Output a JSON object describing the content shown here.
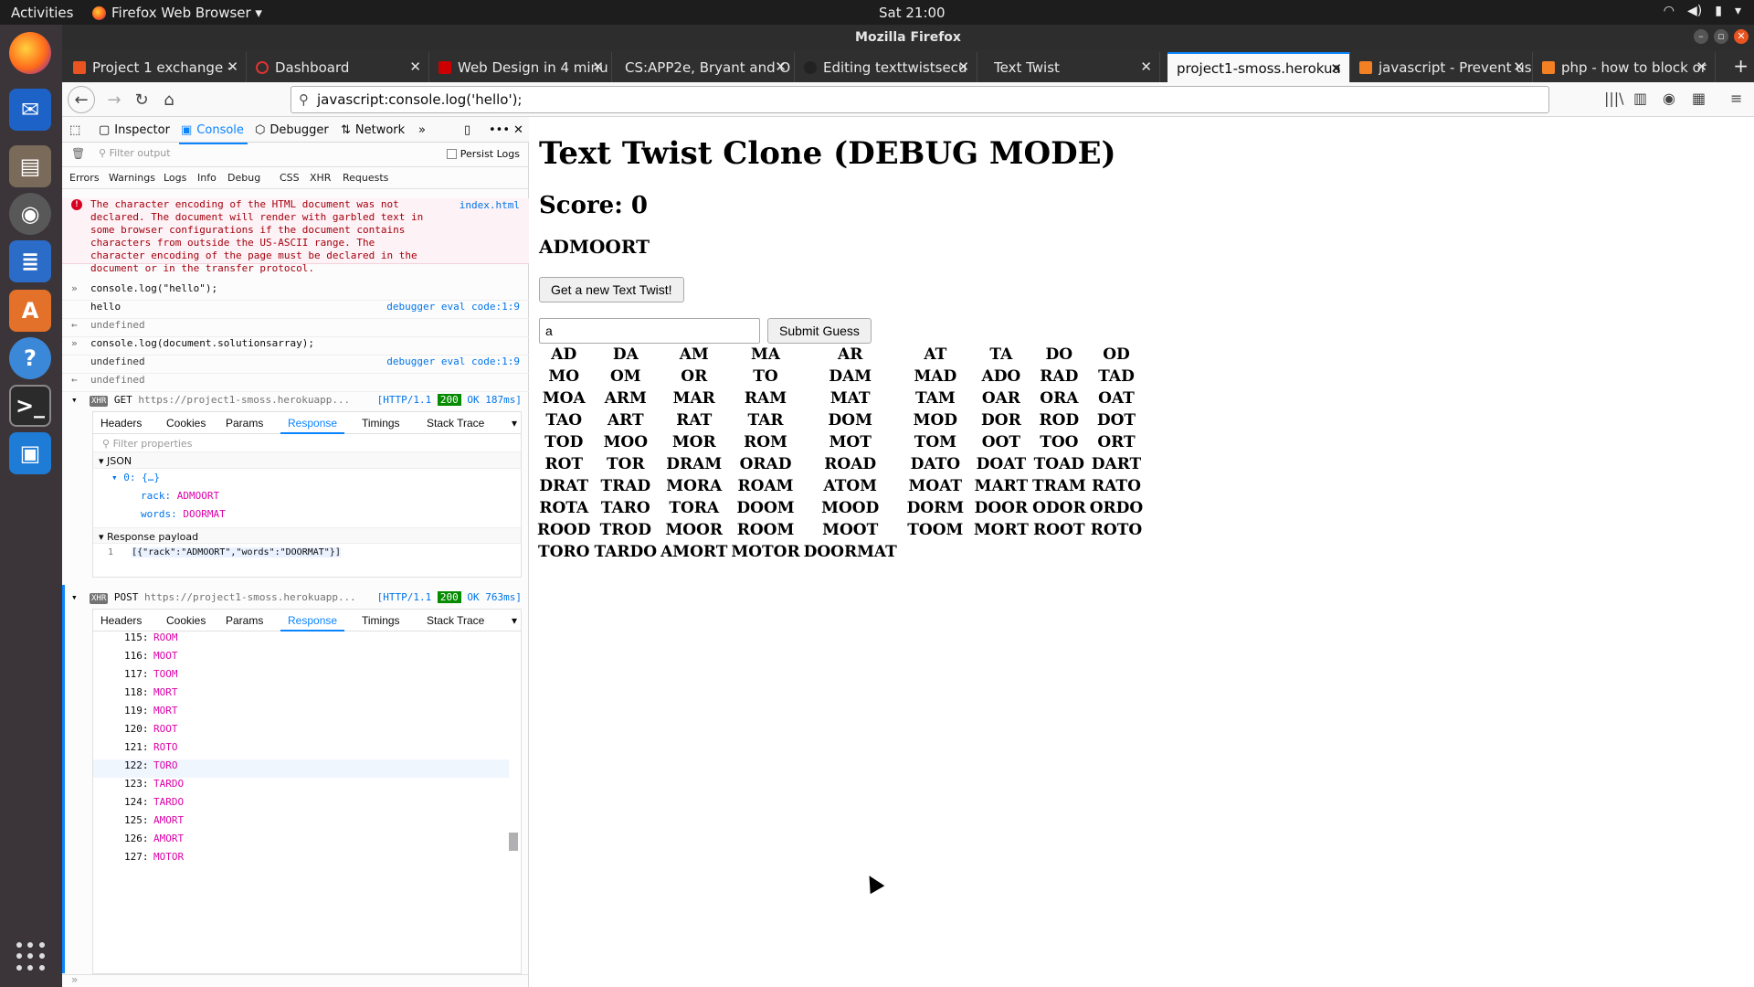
{
  "topbar": {
    "activities": "Activities",
    "app_menu": "Firefox Web Browser ▾",
    "clock": "Sat 21:00"
  },
  "window": {
    "title": "Mozilla Firefox"
  },
  "tabs": [
    {
      "label": "Project 1 exchange - ",
      "favicon_color": "#e95420"
    },
    {
      "label": "Dashboard",
      "favicon_color": "#d33"
    },
    {
      "label": "Web Design in 4 minu",
      "favicon_color": "#c00"
    },
    {
      "label": "CS:APP2e, Bryant and O",
      "favicon_color": ""
    },
    {
      "label": "Editing texttwistsecu",
      "favicon_color": "#222"
    },
    {
      "label": "Text Twist",
      "favicon_color": ""
    },
    {
      "label": "project1-smoss.herokua",
      "favicon_color": "",
      "active": true
    },
    {
      "label": "javascript - Prevent us",
      "favicon_color": "#f48024"
    },
    {
      "label": "php - how to block or",
      "favicon_color": "#f48024"
    }
  ],
  "urlbar": {
    "value": "javascript:console.log('hello');"
  },
  "devtools": {
    "tabs": [
      "Inspector",
      "Console",
      "Debugger",
      "Network"
    ],
    "filter_placeholder": "Filter output",
    "persist_logs": "Persist Logs",
    "categories": [
      "Errors",
      "Warnings",
      "Logs",
      "Info",
      "Debug",
      "CSS",
      "XHR",
      "Requests"
    ],
    "error_lines": [
      "The character encoding of the HTML document was not",
      "declared. The document will render with garbled text in",
      "some browser configurations if the document contains",
      "characters from outside the US-ASCII range. The",
      "character encoding of the page must be declared in the",
      "document or in the transfer protocol."
    ],
    "error_location": "index.html",
    "cmd1": "console.log(\"hello\");",
    "out1": "hello",
    "loc1": "debugger eval code:1:9",
    "ret1": "undefined",
    "cmd2": "console.log(document.solutionsarray);",
    "out2": "undefined",
    "loc2": "debugger eval code:1:9",
    "ret2": "undefined",
    "req1": {
      "badge": "XHR",
      "method": "GET",
      "url": "https://project1-smoss.herokuapp...",
      "proto": "[HTTP/1.1",
      "status": "200",
      "text": "OK 187ms]"
    },
    "req2": {
      "badge": "XHR",
      "method": "POST",
      "url": "https://project1-smoss.herokuapp...",
      "proto": "[HTTP/1.1",
      "status": "200",
      "text": "OK 763ms]"
    },
    "net_tabs": [
      "Headers",
      "Cookies",
      "Params",
      "Response",
      "Timings",
      "Stack Trace"
    ],
    "filter_props": "Filter properties",
    "json_label": "JSON",
    "json_obj": "0: {…}",
    "rack_key": "rack:",
    "rack_val": "ADMOORT",
    "words_key": "words:",
    "words_val": "DOORMAT",
    "payload_label": "Response payload",
    "payload_line_no": "1",
    "payload_text": "[{\"rack\":\"ADMOORT\",\"words\":\"DOORMAT\"}]",
    "response_rows": [
      {
        "n": "115:",
        "w": "ROOM"
      },
      {
        "n": "116:",
        "w": "MOOT"
      },
      {
        "n": "117:",
        "w": "TOOM"
      },
      {
        "n": "118:",
        "w": "MORT"
      },
      {
        "n": "119:",
        "w": "MORT"
      },
      {
        "n": "120:",
        "w": "ROOT"
      },
      {
        "n": "121:",
        "w": "ROTO"
      },
      {
        "n": "122:",
        "w": "TORO"
      },
      {
        "n": "123:",
        "w": "TARDO"
      },
      {
        "n": "124:",
        "w": "TARDO"
      },
      {
        "n": "125:",
        "w": "AMORT"
      },
      {
        "n": "126:",
        "w": "AMORT"
      },
      {
        "n": "127:",
        "w": "MOTOR"
      }
    ]
  },
  "page": {
    "title": "Text Twist Clone (DEBUG MODE)",
    "score": "Score: 0",
    "rack": "ADMOORT",
    "new_button": "Get a new Text Twist!",
    "guess_value": "a",
    "submit_button": "Submit Guess",
    "words": [
      [
        "AD",
        "DA",
        "AM",
        "MA",
        "AR",
        "AT",
        "TA",
        "DO",
        "OD"
      ],
      [
        "MO",
        "OM",
        "OR",
        "TO",
        "DAM",
        "MAD",
        "ADO",
        "RAD",
        "TAD"
      ],
      [
        "MOA",
        "ARM",
        "MAR",
        "RAM",
        "MAT",
        "TAM",
        "OAR",
        "ORA",
        "OAT"
      ],
      [
        "TAO",
        "ART",
        "RAT",
        "TAR",
        "DOM",
        "MOD",
        "DOR",
        "ROD",
        "DOT"
      ],
      [
        "TOD",
        "MOO",
        "MOR",
        "ROM",
        "MOT",
        "TOM",
        "OOT",
        "TOO",
        "ORT"
      ],
      [
        "ROT",
        "TOR",
        "DRAM",
        "ORAD",
        "ROAD",
        "DATO",
        "DOAT",
        "TOAD",
        "DART"
      ],
      [
        "DRAT",
        "TRAD",
        "MORA",
        "ROAM",
        "ATOM",
        "MOAT",
        "MART",
        "TRAM",
        "RATO"
      ],
      [
        "ROTA",
        "TARO",
        "TORA",
        "DOOM",
        "MOOD",
        "DORM",
        "DOOR",
        "ODOR",
        "ORDO"
      ],
      [
        "ROOD",
        "TROD",
        "MOOR",
        "ROOM",
        "MOOT",
        "TOOM",
        "MORT",
        "ROOT",
        "ROTO"
      ],
      [
        "TORO",
        "TARDO",
        "AMORT",
        "MOTOR",
        "DOORMAT",
        "",
        "",
        "",
        ""
      ]
    ]
  }
}
